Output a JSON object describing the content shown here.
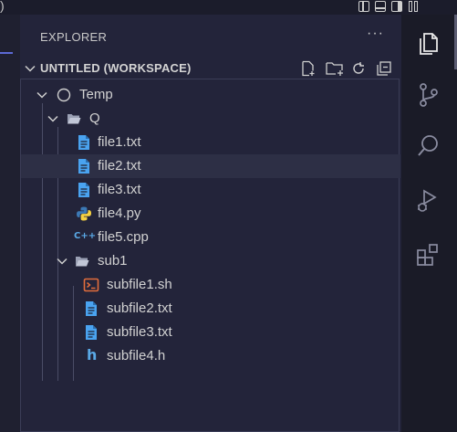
{
  "topbar": {
    "partial_glyph": ")"
  },
  "sidebar": {
    "title": "EXPLORER",
    "more": "···",
    "workspace_label": "UNTITLED (WORKSPACE)"
  },
  "tree": [
    {
      "label": "Temp",
      "kind": "root-folder",
      "expanded": true
    },
    {
      "label": "Q",
      "kind": "folder",
      "expanded": true
    },
    {
      "label": "file1.txt",
      "kind": "txt"
    },
    {
      "label": "file2.txt",
      "kind": "txt",
      "selected": true
    },
    {
      "label": "file3.txt",
      "kind": "txt"
    },
    {
      "label": "file4.py",
      "kind": "python"
    },
    {
      "label": "file5.cpp",
      "kind": "cpp"
    },
    {
      "label": "sub1",
      "kind": "folder",
      "expanded": true
    },
    {
      "label": "subfile1.sh",
      "kind": "shell"
    },
    {
      "label": "subfile2.txt",
      "kind": "txt"
    },
    {
      "label": "subfile3.txt",
      "kind": "txt"
    },
    {
      "label": "subfile4.h",
      "kind": "header"
    }
  ],
  "icons": {
    "cpp_glyph": "C++",
    "header_glyph": "h",
    "shell_glyph": ">_"
  },
  "colors": {
    "txt": "#4aa3f0",
    "python_blue": "#3c79b5",
    "python_yellow": "#f5d142",
    "cpp": "#5aa9e6",
    "shell": "#e26d3c",
    "header": "#5aa9e6",
    "sidebar_bg": "#23243a",
    "activity_bg": "#1a1b27"
  }
}
